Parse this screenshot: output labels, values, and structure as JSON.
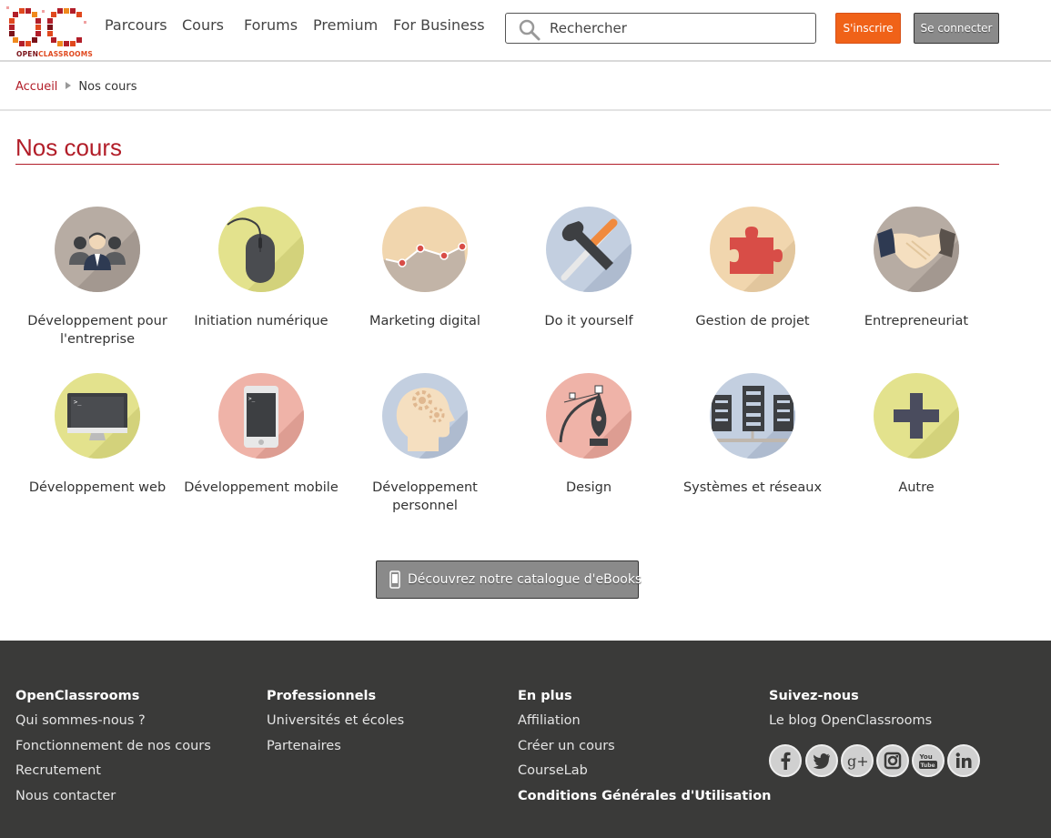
{
  "header": {
    "logo": {
      "mark": "OC",
      "text_open": "OPEN",
      "text_classrooms": "CLASSROOMS"
    },
    "nav": [
      "Parcours",
      "Cours",
      "Forums",
      "Premium",
      "For Business"
    ],
    "search": {
      "placeholder": "Rechercher",
      "icon": "search-icon"
    },
    "signup_label": "S'inscrire",
    "login_label": "Se connecter",
    "colors": {
      "brand": "#b21e29",
      "signup": "#f06218",
      "login": "#8a8a8a"
    }
  },
  "breadcrumb": {
    "home": "Accueil",
    "current": "Nos cours"
  },
  "page": {
    "title": "Nos cours"
  },
  "categories": [
    {
      "label": "Développement pour l'entreprise",
      "icon": "business-people-icon"
    },
    {
      "label": "Initiation numérique",
      "icon": "mouse-icon"
    },
    {
      "label": "Marketing digital",
      "icon": "line-chart-icon"
    },
    {
      "label": "Do it yourself",
      "icon": "tools-icon"
    },
    {
      "label": "Gestion de projet",
      "icon": "puzzle-icon"
    },
    {
      "label": "Entrepreneuriat",
      "icon": "handshake-icon"
    },
    {
      "label": "Développement web",
      "icon": "monitor-icon"
    },
    {
      "label": "Développement mobile",
      "icon": "smartphone-icon"
    },
    {
      "label": "Développement personnel",
      "icon": "head-gears-icon"
    },
    {
      "label": "Design",
      "icon": "pen-tool-icon"
    },
    {
      "label": "Systèmes et réseaux",
      "icon": "servers-icon"
    },
    {
      "label": "Autre",
      "icon": "plus-icon"
    }
  ],
  "ebook_button": {
    "label": "Découvrez notre catalogue d'eBooks",
    "icon": "phone-icon"
  },
  "footer": {
    "columns": [
      {
        "title": "OpenClassrooms",
        "links": [
          "Qui sommes-nous ?",
          "Fonctionnement de nos cours",
          "Recrutement",
          "Nous contacter"
        ]
      },
      {
        "title": "Professionnels",
        "links": [
          "Universités et écoles",
          "Partenaires"
        ]
      },
      {
        "title": "En plus",
        "links": [
          "Affiliation",
          "Créer un cours",
          "CourseLab"
        ],
        "bold_link": "Conditions Générales d'Utilisation"
      },
      {
        "title": "Suivez-nous",
        "links": [
          "Le blog OpenClassrooms"
        ]
      }
    ],
    "socials": [
      "facebook-icon",
      "twitter-icon",
      "google-plus-icon",
      "instagram-icon",
      "youtube-icon",
      "linkedin-icon"
    ],
    "background": "#3a3a39"
  }
}
